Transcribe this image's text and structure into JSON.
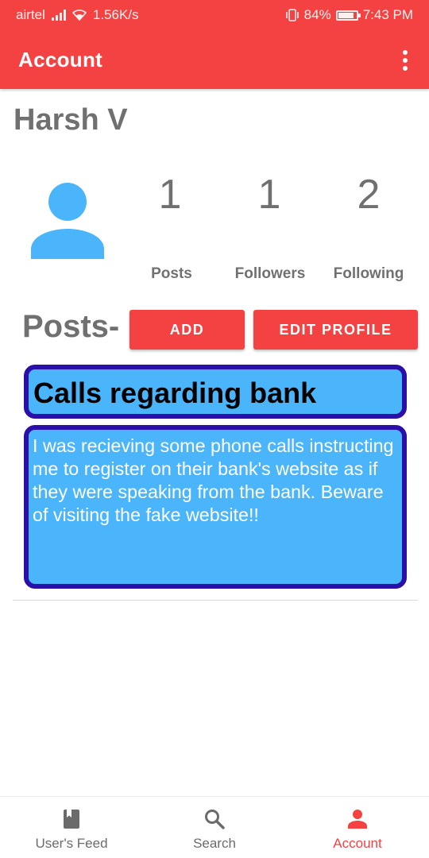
{
  "status_bar": {
    "carrier": "airtel",
    "speed": "1.56K/s",
    "battery": "84%",
    "time": "7:43 PM"
  },
  "appbar": {
    "title": "Account",
    "overflow_icon": "more-vert-icon"
  },
  "profile": {
    "name": "Harsh V",
    "avatar_icon": "person-icon",
    "avatar_color": "#4ab5fb",
    "stats": [
      {
        "value": "1",
        "label": "Posts"
      },
      {
        "value": "1",
        "label": "Followers"
      },
      {
        "value": "2",
        "label": "Following"
      }
    ]
  },
  "posts_section": {
    "heading": "Posts-",
    "add_label": "ADD",
    "edit_label": "EDIT PROFILE",
    "posts": [
      {
        "title": "Calls regarding bank",
        "body": "I was recieving some phone calls instructing me to register on their bank's website as if they were speaking from the bank. Beware of visiting the fake website!!"
      }
    ]
  },
  "bottom_nav": {
    "items": [
      {
        "label": "User's Feed",
        "icon": "book-icon",
        "active": false
      },
      {
        "label": "Search",
        "icon": "search-icon",
        "active": false
      },
      {
        "label": "Account",
        "icon": "person-icon",
        "active": true
      }
    ]
  },
  "colors": {
    "accent": "#f44242",
    "card_fill": "#4ab5fb",
    "card_border": "#2a0fa8",
    "text_gray": "#707070"
  }
}
